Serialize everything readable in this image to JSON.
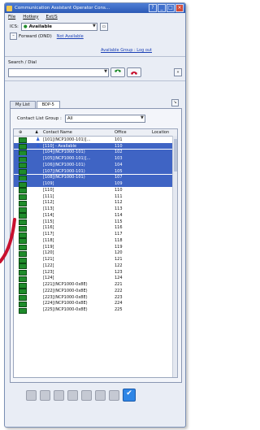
{
  "window": {
    "title": "Communication Assistant Operator Cons..."
  },
  "titlebar_buttons": [
    "?",
    "_",
    "□",
    "×"
  ],
  "menu": [
    "File",
    "Hotkey",
    "Ext/S"
  ],
  "ics": {
    "label": "ICS:",
    "status": "Available",
    "forward_label": "Forward (DND)",
    "forward_value": "Not Available"
  },
  "links": {
    "available_groups": "Available Group : Log out"
  },
  "search": {
    "label": "Search / Dial",
    "value": ""
  },
  "tabs": [
    {
      "label": "My List"
    },
    {
      "label": "BDP-5"
    }
  ],
  "contact_group": {
    "label": "Contact List Group :",
    "value": "All"
  },
  "columns": [
    "Contact Name",
    "Office",
    "Location"
  ],
  "rows": [
    {
      "name": "[101](NCP1000-101)[...",
      "office": "101",
      "sel": false
    },
    {
      "name": "[110] - Available",
      "office": "110",
      "sel": true
    },
    {
      "name": "[104](NCP1000-101)",
      "office": "102",
      "sel": true
    },
    {
      "name": "[105](NCP1000-101)[...",
      "office": "103",
      "sel": true
    },
    {
      "name": "[106](NCP1000-101)",
      "office": "104",
      "sel": true
    },
    {
      "name": "[107](NCP1000-101)",
      "office": "105",
      "sel": true
    },
    {
      "name": "[108](NCP1000-101)",
      "office": "107",
      "sel": true
    },
    {
      "name": "[109]",
      "office": "109",
      "sel": true
    },
    {
      "name": "[110]",
      "office": "110",
      "sel": false
    },
    {
      "name": "[111]",
      "office": "111",
      "sel": false
    },
    {
      "name": "[112]",
      "office": "112",
      "sel": false
    },
    {
      "name": "[113]",
      "office": "113",
      "sel": false
    },
    {
      "name": "[114]",
      "office": "114",
      "sel": false
    },
    {
      "name": "[115]",
      "office": "115",
      "sel": false
    },
    {
      "name": "[116]",
      "office": "116",
      "sel": false
    },
    {
      "name": "[117]",
      "office": "117",
      "sel": false
    },
    {
      "name": "[118]",
      "office": "118",
      "sel": false
    },
    {
      "name": "[119]",
      "office": "119",
      "sel": false
    },
    {
      "name": "[120]",
      "office": "120",
      "sel": false
    },
    {
      "name": "[121]",
      "office": "121",
      "sel": false
    },
    {
      "name": "[122]",
      "office": "122",
      "sel": false
    },
    {
      "name": "[123]",
      "office": "123",
      "sel": false
    },
    {
      "name": "[124]",
      "office": "124",
      "sel": false
    },
    {
      "name": "[221](NCP1000-0x8E)",
      "office": "221",
      "sel": false
    },
    {
      "name": "[222](NCP1000-0x8E)",
      "office": "222",
      "sel": false
    },
    {
      "name": "[223](NCP1000-0x8E)",
      "office": "223",
      "sel": false
    },
    {
      "name": "[224](NCP1000-0x8E)",
      "office": "224",
      "sel": false
    },
    {
      "name": "[225](NCP1000-0x8E)",
      "office": "225",
      "sel": false
    }
  ],
  "bottom_icons": [
    "notepad-icon",
    "pin-icon",
    "phone-icon",
    "chat-icon",
    "grid-icon",
    "clock-icon",
    "speech-icon",
    "check-icon"
  ],
  "colors": {
    "titlebar": "#2c59b5",
    "selection": "#3f64c4",
    "status_green": "#1f8c2b",
    "arrow_red": "#c8102e"
  }
}
